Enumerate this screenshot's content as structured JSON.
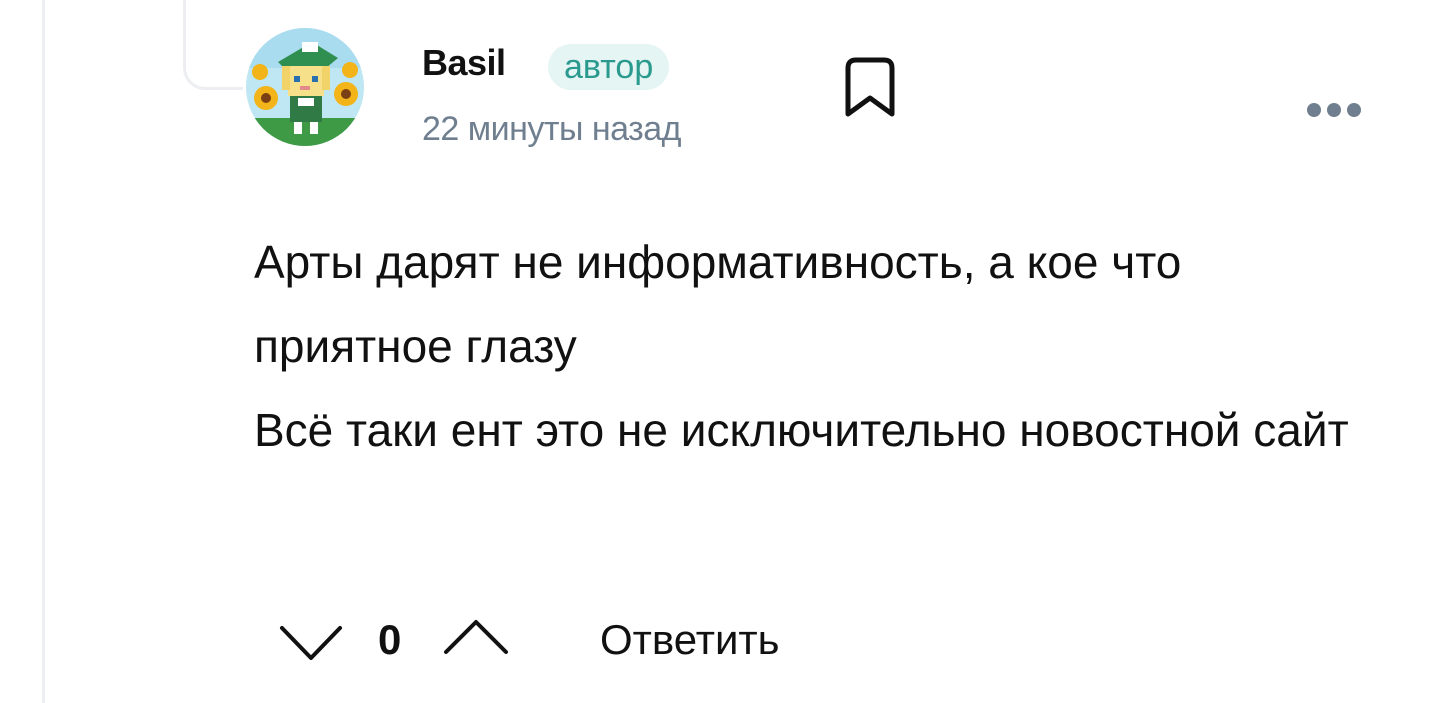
{
  "comment": {
    "author": {
      "name": "Basil",
      "badge": "автор",
      "avatar_icon": "pixel-art-character-avatar"
    },
    "timestamp": "22 минуты назад",
    "body": {
      "paragraph_1": "Арты дарят не информативность, а кое что приятное глазу",
      "paragraph_2": "Всё таки ент это не исключительно новостной сайт"
    },
    "actions": {
      "bookmark_icon": "bookmark-icon",
      "more_icon": "more-horizontal-icon",
      "vote_down_icon": "chevron-down-icon",
      "vote_up_icon": "chevron-up-icon",
      "vote_count": "0",
      "reply_label": "Ответить"
    }
  },
  "colors": {
    "badge_background": "#e5f5f3",
    "badge_text": "#2a9a8f",
    "secondary_text": "#6f7f8f",
    "thread_line": "#eceef1"
  }
}
